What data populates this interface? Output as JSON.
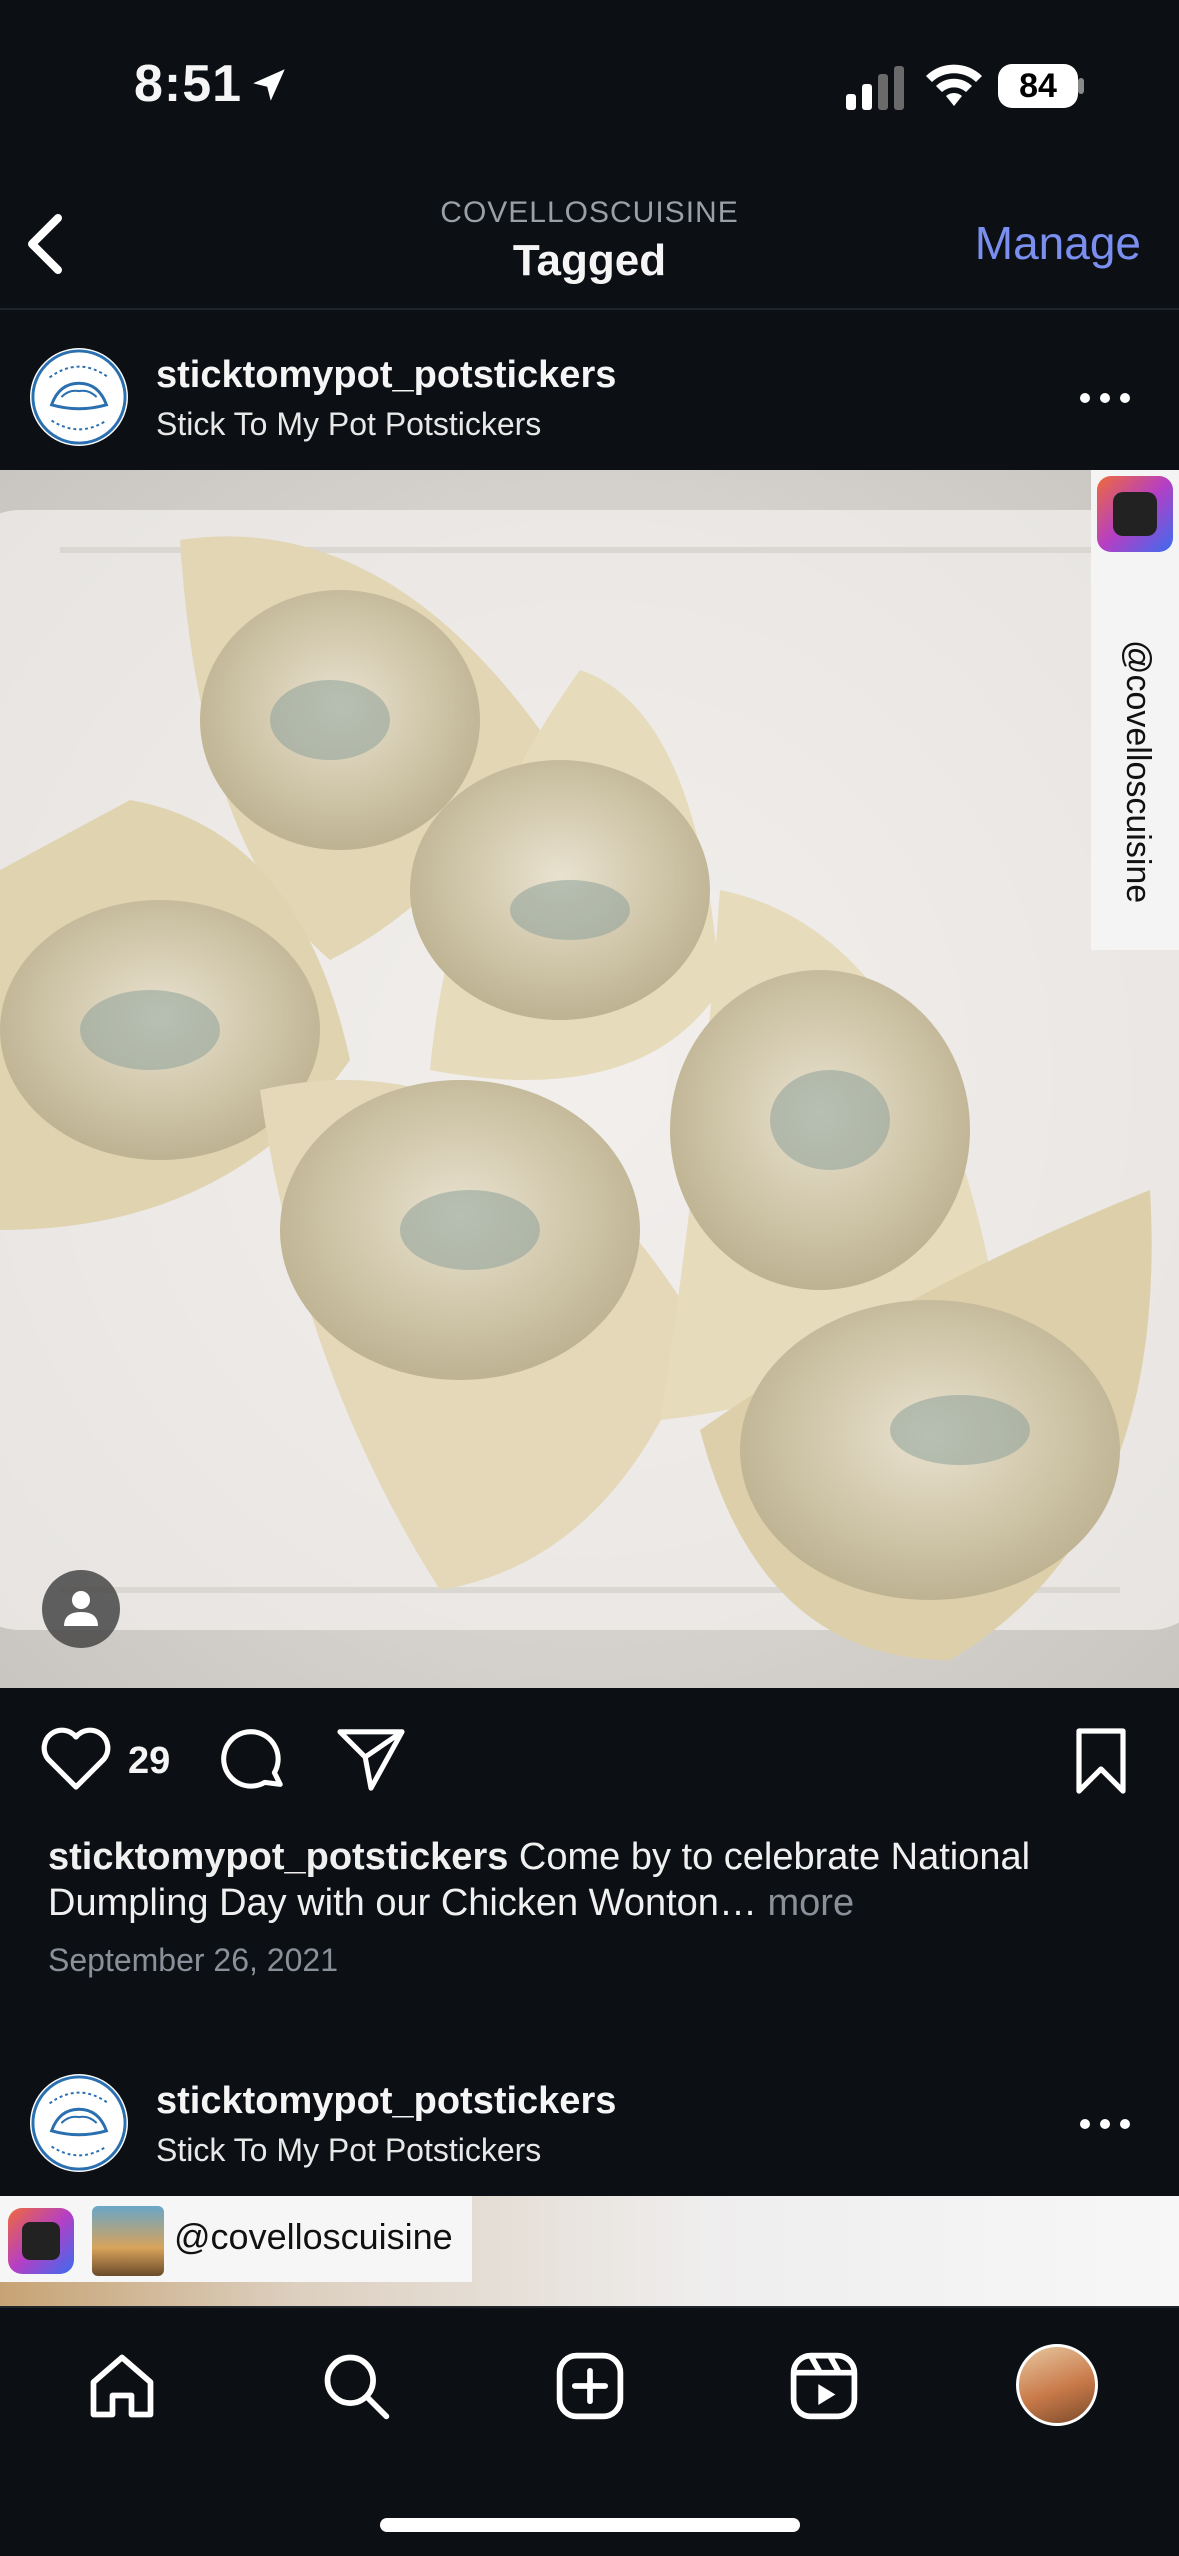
{
  "status_bar": {
    "time": "8:51",
    "battery": "84",
    "icons": [
      "location-arrow-icon",
      "cellular-signal-icon",
      "wifi-icon",
      "battery-icon"
    ]
  },
  "nav": {
    "subtitle": "COVELLOSCUISINE",
    "title": "Tagged",
    "manage_label": "Manage",
    "back_icon": "chevron-left-icon"
  },
  "posts": [
    {
      "username": "sticktomypot_potstickers",
      "display_name": "Stick To My Pot Potstickers",
      "avatar_text": "stick to my pot potstickers",
      "photo_tag": "@covelloscuisine",
      "likes": "29",
      "caption_user": "sticktomypot_potstickers",
      "caption_text": " Come by to celebrate National Dumpling Day with our Chicken Wonton…",
      "caption_more": " more",
      "date": "September 26, 2021"
    },
    {
      "username": "sticktomypot_potstickers",
      "display_name": "Stick To My Pot Potstickers",
      "avatar_text": "stick to my pot potstickers",
      "photo_tag": "@covelloscuisine"
    }
  ],
  "tabbar": {
    "items": [
      "home-icon",
      "search-icon",
      "create-icon",
      "reels-icon",
      "profile-avatar"
    ]
  },
  "colors": {
    "background": "#0c0f14",
    "accent": "#7b8ff0",
    "muted": "#8a9099"
  }
}
